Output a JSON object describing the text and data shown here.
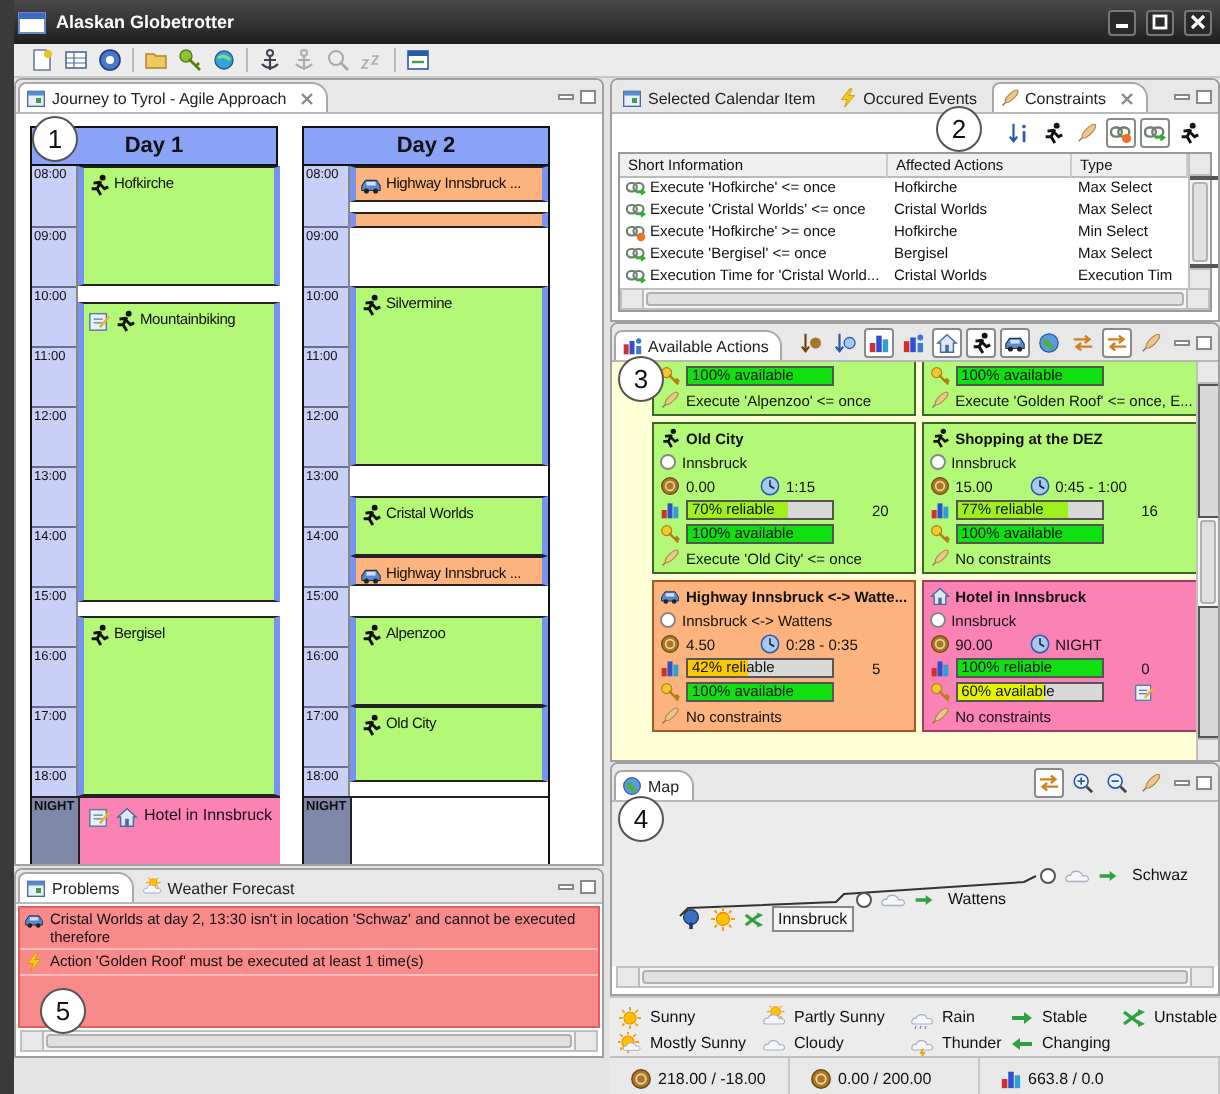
{
  "window": {
    "title": "Alaskan Globetrotter"
  },
  "editor": {
    "tab": {
      "label": "Journey to Tyrol - Agile Approach",
      "selected": true
    },
    "days": [
      {
        "title": "Day 1",
        "hours": [
          "08:00",
          "09:00",
          "10:00",
          "11:00",
          "12:00",
          "13:00",
          "14:00",
          "15:00",
          "16:00",
          "17:00",
          "18:00"
        ],
        "night_label": "NIGHT",
        "events": [
          {
            "kind": "activity",
            "title": "Hofkirche",
            "note": false
          },
          {
            "kind": "activity",
            "title": "Mountainbiking",
            "note": true
          },
          {
            "kind": "activity",
            "title": "Bergisel",
            "note": false
          }
        ],
        "night": {
          "kind": "hotel",
          "title": "Hotel in Innsbruck",
          "note": true
        }
      },
      {
        "title": "Day 2",
        "hours": [
          "08:00",
          "09:00",
          "10:00",
          "11:00",
          "12:00",
          "13:00",
          "14:00",
          "15:00",
          "16:00",
          "17:00",
          "18:00"
        ],
        "night_label": "NIGHT",
        "events": [
          {
            "kind": "transport",
            "title": "Highway Innsbruck ...",
            "note": false
          },
          {
            "kind": "transport",
            "note": false
          },
          {
            "kind": "activity",
            "title": "Silvermine",
            "note": false
          },
          {
            "kind": "activity",
            "title": "Cristal Worlds",
            "note": false
          },
          {
            "kind": "transport",
            "title": "Highway Innsbruck ...",
            "note": false
          },
          {
            "kind": "activity",
            "title": "Alpenzoo",
            "note": false
          },
          {
            "kind": "activity",
            "title": "Old City",
            "note": false
          }
        ]
      }
    ]
  },
  "problems": {
    "tabs": [
      {
        "label": "Problems",
        "selected": true
      },
      {
        "label": "Weather Forecast",
        "selected": false
      }
    ],
    "messages": [
      {
        "kind": "transport",
        "text": "Cristal Worlds at day 2, 13:30  isn't in location 'Schwaz' and cannot be executed therefore"
      },
      {
        "kind": "event",
        "text": "Action 'Golden Roof' must be executed at least 1 time(s)"
      }
    ]
  },
  "info_panel": {
    "tabs": [
      {
        "label": "Selected Calendar Item",
        "selected": false,
        "kind": "calendar"
      },
      {
        "label": "Occured Events",
        "selected": false,
        "kind": "lightning"
      },
      {
        "label": "Constraints",
        "selected": true,
        "kind": "feather"
      }
    ],
    "toolbar": [
      {
        "kind": "sort",
        "pressed": false
      },
      {
        "kind": "runner",
        "pressed": false
      },
      {
        "kind": "feather",
        "pressed": false
      },
      {
        "kind": "link_alert",
        "pressed": true
      },
      {
        "kind": "link_ok",
        "pressed": true
      },
      {
        "kind": "runner",
        "pressed": false
      }
    ],
    "columns": [
      "Short Information",
      "Affected Actions",
      "Type"
    ],
    "rows": [
      {
        "kind": "ok",
        "info": "Execute 'Hofkirche' <= once",
        "actions": "Hofkirche",
        "type": "Max Select"
      },
      {
        "kind": "ok",
        "info": "Execute 'Cristal Worlds' <= once",
        "actions": "Cristal Worlds",
        "type": "Max Select"
      },
      {
        "kind": "alert",
        "info": "Execute 'Hofkirche' >= once",
        "actions": "Hofkirche",
        "type": "Min Select"
      },
      {
        "kind": "ok",
        "info": "Execute 'Bergisel' <= once",
        "actions": "Bergisel",
        "type": "Max Select"
      },
      {
        "kind": "ok",
        "info": "Execution Time for 'Cristal World...",
        "actions": "Cristal Worlds",
        "type": "Execution Tim"
      }
    ]
  },
  "actions_panel": {
    "tab": {
      "label": "Available Actions",
      "selected": true
    },
    "toolbar": [
      {
        "kind": "sort_euro",
        "pressed": false
      },
      {
        "kind": "sort_clock",
        "pressed": false
      },
      {
        "kind": "chart",
        "pressed": true
      },
      {
        "kind": "chart_person",
        "pressed": false
      },
      {
        "kind": "house",
        "pressed": true
      },
      {
        "kind": "runner",
        "pressed": true
      },
      {
        "kind": "car",
        "pressed": true
      },
      {
        "kind": "globe",
        "pressed": false
      },
      {
        "kind": "swap",
        "pressed": false
      },
      {
        "kind": "swap",
        "pressed": true
      },
      {
        "kind": "feather",
        "pressed": false
      }
    ],
    "cards": [
      {
        "kind": "activity",
        "availability": {
          "level": 1,
          "label": "100% available"
        },
        "constraint": "Execute 'Alpenzoo' <= once"
      },
      {
        "kind": "activity",
        "availability": {
          "level": 1,
          "label": "100% available"
        },
        "constraint": "Execute 'Golden Roof' <= once, E..."
      },
      {
        "kind": "activity",
        "title": "Old City",
        "location": "Innsbruck",
        "location_selected": false,
        "cost": "0.00",
        "duration": "1:15",
        "reliability": {
          "level": 0.7,
          "label": "70% reliable"
        },
        "count": "20",
        "availability": {
          "level": 1,
          "label": "100% available"
        },
        "note": false,
        "constraint": "Execute 'Old City' <= once"
      },
      {
        "kind": "activity",
        "title": "Shopping at the DEZ",
        "location": "Innsbruck",
        "location_selected": false,
        "cost": "15.00",
        "duration": "0:45 - 1:00",
        "reliability": {
          "level": 0.77,
          "label": "77% reliable"
        },
        "count": "16",
        "availability": {
          "level": 1,
          "label": "100% available"
        },
        "note": false,
        "constraint": "No constraints"
      },
      {
        "kind": "transport",
        "title": "Highway Innsbruck <-> Watte...",
        "location": "Innsbruck <-> Wattens",
        "location_selected": false,
        "cost": "4.50",
        "duration": "0:28 - 0:35",
        "reliability": {
          "level": 0.42,
          "label": "42% reliable"
        },
        "count": "5",
        "availability": {
          "level": 1,
          "label": "100% available"
        },
        "note": false,
        "constraint": "No constraints"
      },
      {
        "kind": "hotel",
        "title": "Hotel in Innsbruck",
        "location": "Innsbruck",
        "location_selected": false,
        "cost": "90.00",
        "duration": "NIGHT",
        "reliability": {
          "level": 1,
          "label": "100% reliable"
        },
        "count": "0",
        "availability": {
          "level": 0.6,
          "label": "60% available"
        },
        "note": true,
        "constraint": "No constraints"
      }
    ]
  },
  "map": {
    "tab": {
      "label": "Map",
      "selected": true
    },
    "toolbar": [
      {
        "kind": "swap",
        "pressed": true
      },
      {
        "kind": "zoom_in",
        "pressed": false
      },
      {
        "kind": "zoom_out",
        "pressed": false
      },
      {
        "kind": "feather",
        "pressed": false
      }
    ],
    "places": [
      {
        "name": "Innsbruck",
        "current": true,
        "selected": true,
        "weather": {
          "kind": "sunny"
        },
        "trend": {
          "kind": "unstable"
        }
      },
      {
        "name": "Wattens",
        "current": false,
        "selected": false,
        "weather": {
          "kind": "cloudy"
        },
        "trend": {
          "kind": "stable"
        }
      },
      {
        "name": "Schwaz",
        "current": false,
        "selected": false,
        "weather": {
          "kind": "cloudy"
        },
        "trend": {
          "kind": "stable"
        }
      }
    ],
    "legend": [
      {
        "kind": "sunny",
        "label": "Sunny"
      },
      {
        "kind": "partly_sunny",
        "label": "Partly Sunny"
      },
      {
        "kind": "rain",
        "label": "Rain"
      },
      {
        "kind": "stable",
        "label": "Stable"
      },
      {
        "kind": "unstable",
        "label": "Unstable"
      },
      {
        "kind": "mostly_sunny",
        "label": "Mostly Sunny"
      },
      {
        "kind": "cloudy",
        "label": "Cloudy"
      },
      {
        "kind": "thunder",
        "label": "Thunder"
      },
      {
        "kind": "changing",
        "label": "Changing"
      }
    ]
  },
  "status_bar": [
    {
      "kind": "money",
      "value": "218.00 / -18.00"
    },
    {
      "kind": "money",
      "value": "0.00 / 200.00"
    },
    {
      "kind": "rating",
      "value": "663.8 / 0.0"
    }
  ],
  "callouts": [
    "1",
    "2",
    "3",
    "4",
    "5"
  ]
}
